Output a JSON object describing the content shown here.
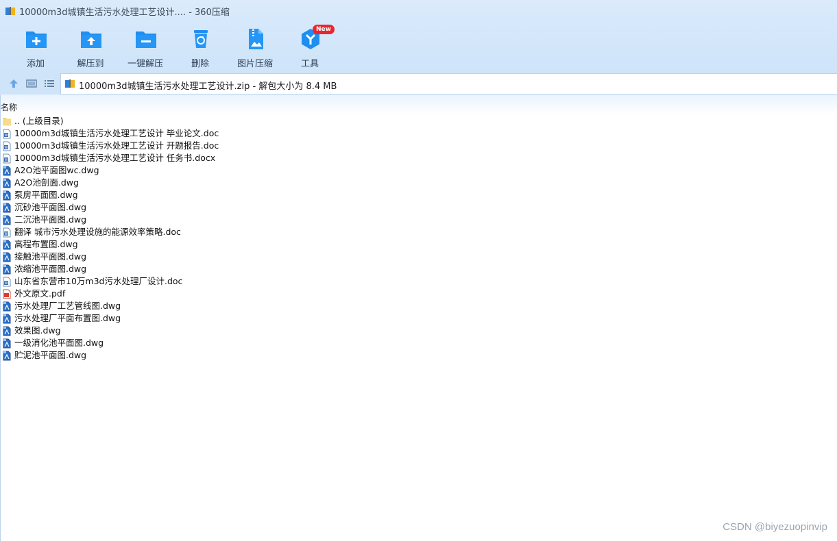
{
  "window": {
    "title": "10000m3d城镇生活污水处理工艺设计.... - 360压缩"
  },
  "toolbar": {
    "items": [
      {
        "label": "添加",
        "icon": "add-folder-icon"
      },
      {
        "label": "解压到",
        "icon": "extract-to-icon"
      },
      {
        "label": "一键解压",
        "icon": "one-click-extract-icon"
      },
      {
        "label": "删除",
        "icon": "delete-icon"
      },
      {
        "label": "图片压缩",
        "icon": "image-compress-icon"
      },
      {
        "label": "工具",
        "icon": "tools-icon",
        "badge": "New"
      }
    ]
  },
  "address": {
    "text": "10000m3d城镇生活污水处理工艺设计.zip - 解包大小为 8.4 MB"
  },
  "list": {
    "header": "名称",
    "items": [
      {
        "name": ".. (上级目录)",
        "type": "folder"
      },
      {
        "name": "10000m3d城镇生活污水处理工艺设计 毕业论文.doc",
        "type": "doc"
      },
      {
        "name": "10000m3d城镇生活污水处理工艺设计 开题报告.doc",
        "type": "doc"
      },
      {
        "name": "10000m3d城镇生活污水处理工艺设计 任务书.docx",
        "type": "docx"
      },
      {
        "name": "A2O池平面图wc.dwg",
        "type": "dwg"
      },
      {
        "name": "A2O池剖面.dwg",
        "type": "dwg"
      },
      {
        "name": "泵房平面图.dwg",
        "type": "dwg"
      },
      {
        "name": "沉砂池平面图.dwg",
        "type": "dwg"
      },
      {
        "name": "二沉池平面图.dwg",
        "type": "dwg"
      },
      {
        "name": "翻译 城市污水处理设施的能源效率策略.doc",
        "type": "doc"
      },
      {
        "name": "高程布置图.dwg",
        "type": "dwg"
      },
      {
        "name": "接触池平面图.dwg",
        "type": "dwg"
      },
      {
        "name": "浓缩池平面图.dwg",
        "type": "dwg"
      },
      {
        "name": "山东省东营市10万m3d污水处理厂设计.doc",
        "type": "doc"
      },
      {
        "name": "外文原文.pdf",
        "type": "pdf"
      },
      {
        "name": "污水处理厂工艺管线图.dwg",
        "type": "dwg"
      },
      {
        "name": "污水处理厂平面布置图.dwg",
        "type": "dwg"
      },
      {
        "name": "效果图.dwg",
        "type": "dwg"
      },
      {
        "name": "一级消化池平面图.dwg",
        "type": "dwg"
      },
      {
        "name": "贮泥池平面图.dwg",
        "type": "dwg"
      }
    ]
  },
  "watermark": "CSDN @biyezuopinvip",
  "colors": {
    "toolbar_bg": "#d6e8fb",
    "icon_blue": "#1e8ef0",
    "badge_red": "#e8262f"
  }
}
